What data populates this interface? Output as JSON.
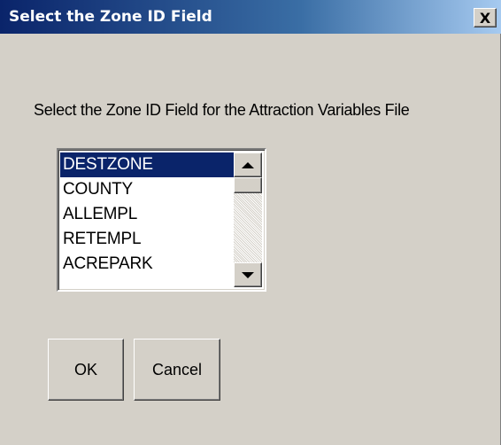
{
  "window": {
    "title": "Select the Zone ID Field",
    "close_label": "X"
  },
  "dialog": {
    "prompt": "Select the Zone ID Field for the Attraction Variables File",
    "list": {
      "items": [
        "DESTZONE",
        "COUNTY",
        "ALLEMPL",
        "RETEMPL",
        "ACREPARK"
      ],
      "selected": "DESTZONE"
    },
    "buttons": {
      "ok_label": "OK",
      "cancel_label": "Cancel"
    }
  },
  "colors": {
    "dialog_bg": "#d4d0c8",
    "titlebar_start": "#0a246a",
    "titlebar_end": "#a6caf0",
    "selection_bg": "#0a246a"
  },
  "icons": {
    "close": "close-icon",
    "scroll_up": "arrow-up-icon",
    "scroll_down": "arrow-down-icon"
  }
}
